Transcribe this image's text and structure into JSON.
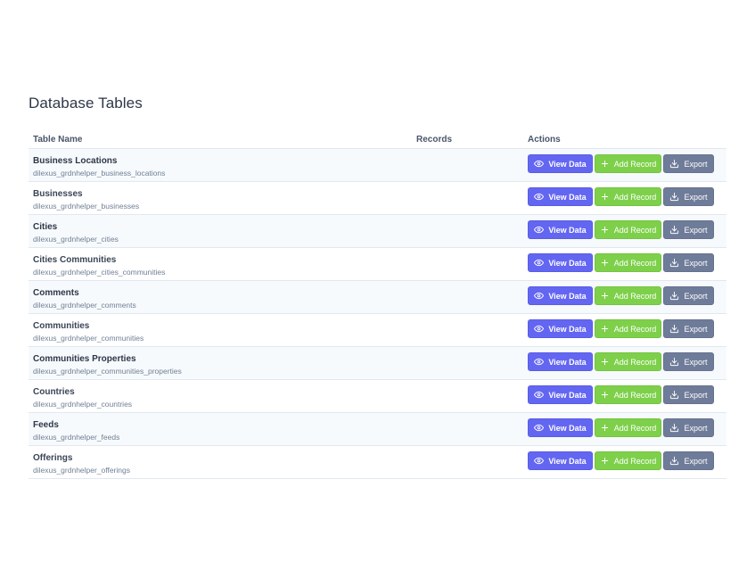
{
  "page": {
    "title": "Database Tables"
  },
  "table": {
    "headers": {
      "name": "Table Name",
      "records": "Records",
      "actions": "Actions"
    },
    "actions": {
      "view": "View Data",
      "add": "Add Record",
      "export": "Export"
    },
    "rows": [
      {
        "name": "Business Locations",
        "table": "dilexus_grdnhelper_business_locations",
        "records": ""
      },
      {
        "name": "Businesses",
        "table": "dilexus_grdnhelper_businesses",
        "records": ""
      },
      {
        "name": "Cities",
        "table": "dilexus_grdnhelper_cities",
        "records": ""
      },
      {
        "name": "Cities Communities",
        "table": "dilexus_grdnhelper_cities_communities",
        "records": ""
      },
      {
        "name": "Comments",
        "table": "dilexus_grdnhelper_comments",
        "records": ""
      },
      {
        "name": "Communities",
        "table": "dilexus_grdnhelper_communities",
        "records": ""
      },
      {
        "name": "Communities Properties",
        "table": "dilexus_grdnhelper_communities_properties",
        "records": ""
      },
      {
        "name": "Countries",
        "table": "dilexus_grdnhelper_countries",
        "records": ""
      },
      {
        "name": "Feeds",
        "table": "dilexus_grdnhelper_feeds",
        "records": ""
      },
      {
        "name": "Offerings",
        "table": "dilexus_grdnhelper_offerings",
        "records": ""
      }
    ]
  },
  "icons": {
    "view": "eye-icon",
    "add": "plus-icon",
    "export": "download-icon"
  },
  "colors": {
    "view_button": "#6366f1",
    "add_button": "#7ed04b",
    "export_button": "#6f7c99",
    "row_alt": "#f7fafc"
  }
}
